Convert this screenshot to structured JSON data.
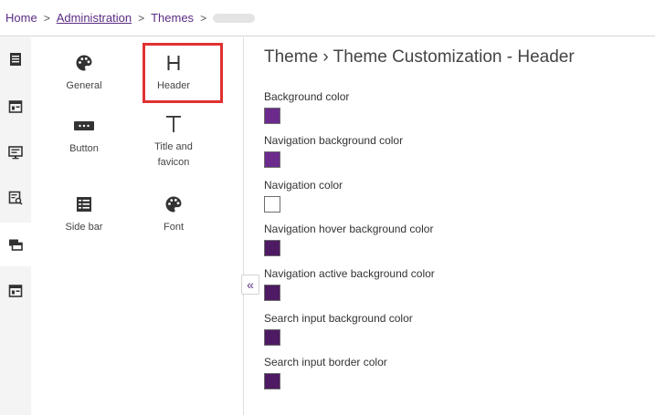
{
  "breadcrumb": {
    "home": "Home",
    "separator": ">",
    "administration": "Administration",
    "themes": "Themes"
  },
  "rail": {
    "items": [
      {
        "icon": "list-page-icon"
      },
      {
        "icon": "layout-window-icon"
      },
      {
        "icon": "presentation-icon"
      },
      {
        "icon": "search-document-icon"
      },
      {
        "icon": "stacked-windows-icon",
        "active": true
      },
      {
        "icon": "layout-window-icon"
      }
    ]
  },
  "tiles": {
    "general": {
      "label": "General",
      "icon": "palette-icon"
    },
    "header": {
      "label": "Header",
      "icon": "header-h-icon",
      "highlighted": true
    },
    "button": {
      "label": "Button",
      "icon": "button-icon"
    },
    "title_favicon": {
      "label_line1": "Title and",
      "label_line2": "favicon",
      "icon": "text-t-icon"
    },
    "side_bar": {
      "label": "Side bar",
      "icon": "side-bar-icon"
    },
    "font": {
      "label": "Font",
      "icon": "palette-icon"
    }
  },
  "collapse": {
    "glyph": "«"
  },
  "main": {
    "title": "Theme › Theme Customization - Header",
    "fields": [
      {
        "label": "Background color",
        "color": "#6b2a8c"
      },
      {
        "label": "Navigation background color",
        "color": "#6b2a8c"
      },
      {
        "label": "Navigation color",
        "color": "#ffffff"
      },
      {
        "label": "Navigation hover background color",
        "color": "#4e1a63"
      },
      {
        "label": "Navigation active background color",
        "color": "#4e1a63"
      },
      {
        "label": "Search input background color",
        "color": "#4e1a63"
      },
      {
        "label": "Search input border color",
        "color": "#4e1a63"
      }
    ]
  },
  "colors": {
    "accent": "#5a2d82",
    "highlight": "#e03131",
    "rail_bg": "#f4f4f4"
  }
}
